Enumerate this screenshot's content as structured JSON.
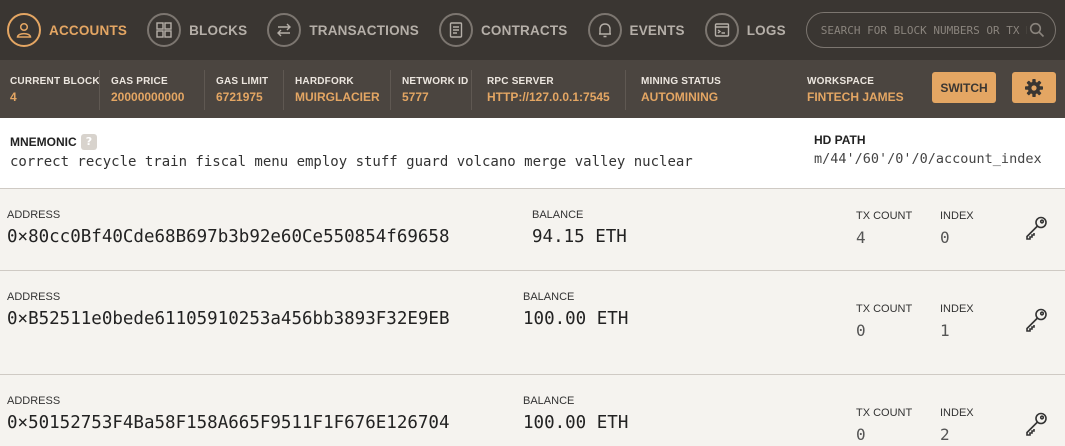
{
  "nav": {
    "items": [
      {
        "label": "ACCOUNTS",
        "icon": "user-icon"
      },
      {
        "label": "BLOCKS",
        "icon": "blocks-icon"
      },
      {
        "label": "TRANSACTIONS",
        "icon": "transactions-icon"
      },
      {
        "label": "CONTRACTS",
        "icon": "contracts-icon"
      },
      {
        "label": "EVENTS",
        "icon": "bell-icon"
      },
      {
        "label": "LOGS",
        "icon": "logs-icon"
      }
    ],
    "search_placeholder": "SEARCH FOR BLOCK NUMBERS OR TX HASHES"
  },
  "status": {
    "current_block": {
      "label": "CURRENT BLOCK",
      "value": "4"
    },
    "gas_price": {
      "label": "GAS PRICE",
      "value": "20000000000"
    },
    "gas_limit": {
      "label": "GAS LIMIT",
      "value": "6721975"
    },
    "hardfork": {
      "label": "HARDFORK",
      "value": "MUIRGLACIER"
    },
    "network_id": {
      "label": "NETWORK ID",
      "value": "5777"
    },
    "rpc_server": {
      "label": "RPC SERVER",
      "value": "HTTP://127.0.0.1:7545"
    },
    "mining_status": {
      "label": "MINING STATUS",
      "value": "AUTOMINING"
    },
    "workspace": {
      "label": "WORKSPACE",
      "value": "FINTECH JAMES"
    },
    "switch_label": "SWITCH"
  },
  "mnemonic": {
    "label": "MNEMONIC",
    "help": "?",
    "words": "correct recycle train fiscal menu employ stuff guard volcano merge valley nuclear",
    "hd_path_label": "HD PATH",
    "hd_path": "m/44'/60'/0'/0/account_index"
  },
  "accounts": [
    {
      "address_label": "ADDRESS",
      "address": "0×80cc0Bf40Cde68B697b3b92e60Ce550854f69658",
      "balance_label": "BALANCE",
      "balance": "94.15 ETH",
      "tx_label": "TX COUNT",
      "tx_count": "4",
      "index_label": "INDEX",
      "index": "0"
    },
    {
      "address_label": "ADDRESS",
      "address": "0×B52511e0bede61105910253a456bb3893F32E9EB",
      "balance_label": "BALANCE",
      "balance": "100.00 ETH",
      "tx_label": "TX COUNT",
      "tx_count": "0",
      "index_label": "INDEX",
      "index": "1"
    },
    {
      "address_label": "ADDRESS",
      "address": "0×50152753F4Ba58F158A665F9511F1F676E126704",
      "balance_label": "BALANCE",
      "balance": "100.00 ETH",
      "tx_label": "TX COUNT",
      "tx_count": "0",
      "index_label": "INDEX",
      "index": "2"
    }
  ],
  "colors": {
    "accent": "#e4a663",
    "nav_bg": "#3a3632",
    "status_bg": "#4b4540"
  }
}
